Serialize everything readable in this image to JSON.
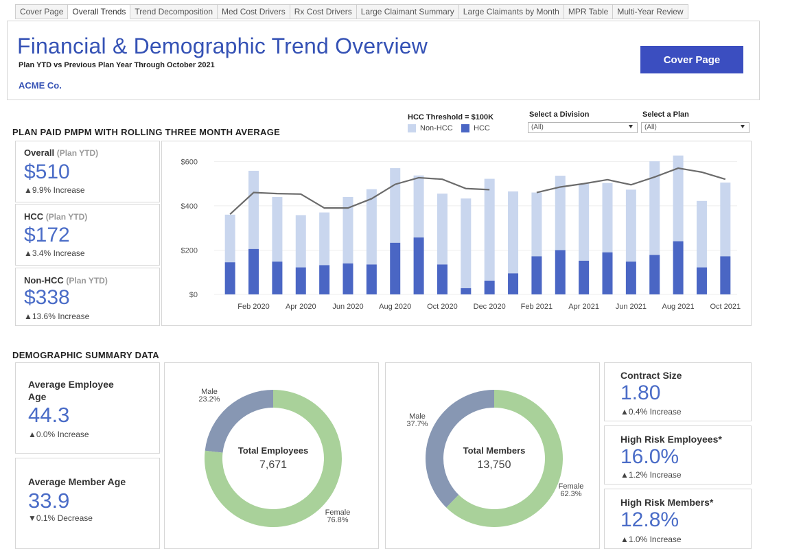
{
  "tabs": [
    {
      "label": "Cover Page",
      "active": false
    },
    {
      "label": "Overall Trends",
      "active": true
    },
    {
      "label": "Trend Decomposition",
      "active": false
    },
    {
      "label": "Med Cost Drivers",
      "active": false
    },
    {
      "label": "Rx Cost Drivers",
      "active": false
    },
    {
      "label": "Large Claimant Summary",
      "active": false
    },
    {
      "label": "Large Claimants by Month",
      "active": false
    },
    {
      "label": "MPR Table",
      "active": false
    },
    {
      "label": "Multi-Year Review",
      "active": false
    }
  ],
  "header": {
    "title": "Financial & Demographic Trend Overview",
    "subtitle": "Plan YTD vs Previous Plan Year Through October 2021",
    "company": "ACME Co.",
    "cover_button": "Cover Page"
  },
  "pmpm_section": {
    "title": "PLAN PAID PMPM WITH ROLLING THREE MONTH AVERAGE"
  },
  "legend": {
    "title": "HCC Threshold = $100K",
    "items": [
      {
        "label": "Non-HCC",
        "color": "#c9d6ee"
      },
      {
        "label": "HCC",
        "color": "#4a66c4"
      }
    ]
  },
  "filters": {
    "division": {
      "label": "Select a Division",
      "value": "(All)"
    },
    "plan": {
      "label": "Select a Plan",
      "value": "(All)"
    }
  },
  "kpis": {
    "overall": {
      "label": "Overall",
      "qualifier": "(Plan YTD)",
      "value": "$510",
      "change": "▲9.9% Increase"
    },
    "hcc": {
      "label": "HCC",
      "qualifier": "(Plan YTD)",
      "value": "$172",
      "change": "▲3.4% Increase"
    },
    "non_hcc": {
      "label": "Non-HCC",
      "qualifier": "(Plan YTD)",
      "value": "$338",
      "change": "▲13.6% Increase"
    }
  },
  "demographic_section": {
    "title": "DEMOGRAPHIC SUMMARY DATA"
  },
  "demographics": {
    "avg_employee_age": {
      "label_line1": "Average Employee",
      "label_line2": "Age",
      "value": "44.3",
      "change": "▲0.0% Increase"
    },
    "avg_member_age": {
      "label": "Average Member Age",
      "value": "33.9",
      "change": "▼0.1% Decrease"
    },
    "contract_size": {
      "label": "Contract Size",
      "value": "1.80",
      "change": "▲0.4% Increase"
    },
    "high_risk_employees": {
      "label": "High Risk Employees*",
      "value": "16.0%",
      "change": "▲1.2% Increase"
    },
    "high_risk_members": {
      "label": "High Risk Members*",
      "value": "12.8%",
      "change": "▲1.0% Increase"
    }
  },
  "donuts": {
    "employees": {
      "center_label": "Total Employees",
      "center_value": "7,671",
      "male": {
        "label": "Male",
        "pct_text": "23.2%",
        "pct": 23.2,
        "color": "#8797b3"
      },
      "female": {
        "label": "Female",
        "pct_text": "76.8%",
        "pct": 76.8,
        "color": "#a9d19a"
      }
    },
    "members": {
      "center_label": "Total Members",
      "center_value": "13,750",
      "male": {
        "label": "Male",
        "pct_text": "37.7%",
        "pct": 37.7,
        "color": "#8797b3"
      },
      "female": {
        "label": "Female",
        "pct_text": "62.3%",
        "pct": 62.3,
        "color": "#a9d19a"
      }
    }
  },
  "chart_data": {
    "type": "bar",
    "stacked": true,
    "categories": [
      "Jan 2020",
      "Feb 2020",
      "Mar 2020",
      "Apr 2020",
      "May 2020",
      "Jun 2020",
      "Jul 2020",
      "Aug 2020",
      "Sep 2020",
      "Oct 2020",
      "Nov 2020",
      "Dec 2020",
      "Jan 2021",
      "Feb 2021",
      "Mar 2021",
      "Apr 2021",
      "May 2021",
      "Jun 2021",
      "Jul 2021",
      "Aug 2021",
      "Sep 2021",
      "Oct 2021"
    ],
    "x_tick_labels": [
      "Feb 2020",
      "Apr 2020",
      "Jun 2020",
      "Aug 2020",
      "Oct 2020",
      "Dec 2020",
      "Feb 2021",
      "Apr 2021",
      "Jun 2021",
      "Aug 2021",
      "Oct 2021"
    ],
    "series": [
      {
        "name": "HCC",
        "values": [
          145,
          205,
          148,
          122,
          132,
          140,
          135,
          233,
          257,
          135,
          28,
          62,
          95,
          172,
          200,
          152,
          190,
          148,
          178,
          240,
          122,
          172
        ]
      },
      {
        "name": "Non-HCC",
        "values": [
          215,
          353,
          292,
          236,
          238,
          300,
          340,
          337,
          280,
          320,
          405,
          460,
          370,
          288,
          336,
          348,
          313,
          325,
          423,
          387,
          300,
          333
        ]
      }
    ],
    "line": {
      "name": "Rolling Three Month Average",
      "values": [
        362,
        460,
        455,
        453,
        390,
        390,
        432,
        497,
        527,
        520,
        478,
        473,
        null,
        460,
        485,
        500,
        518,
        495,
        530,
        570,
        552,
        520
      ],
      "color": "#6b6b6b"
    },
    "y_ticks": [
      "$0",
      "$200",
      "$400",
      "$600"
    ],
    "ylim": [
      0,
      660
    ],
    "grid": true
  }
}
